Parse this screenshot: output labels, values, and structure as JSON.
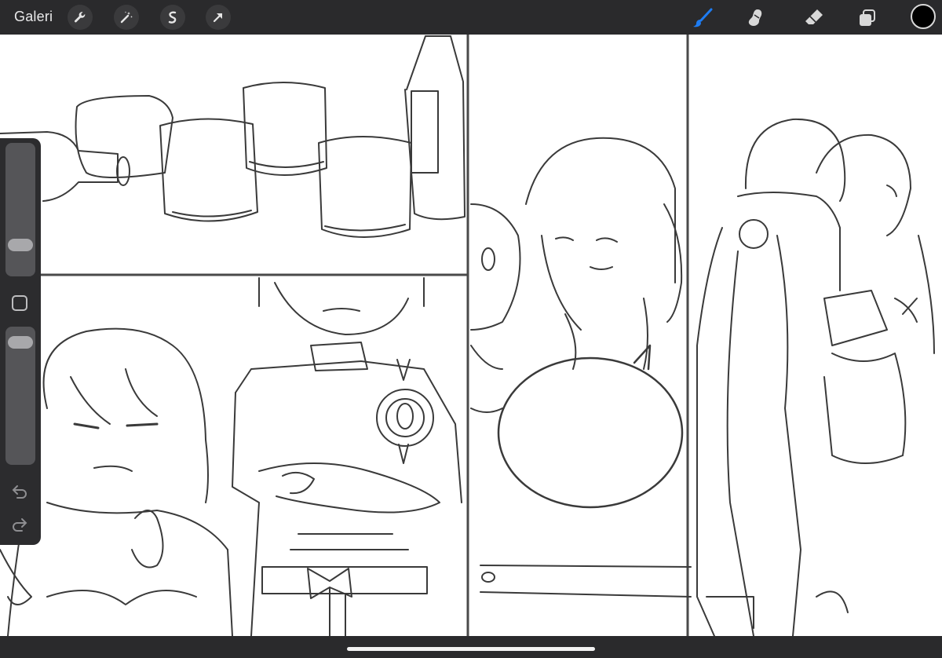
{
  "toolbar": {
    "gallery_label": "Galeri",
    "left_tools": [
      {
        "name": "wrench-icon"
      },
      {
        "name": "magic-wand-icon"
      },
      {
        "name": "selection-icon"
      },
      {
        "name": "transform-arrow-icon"
      }
    ],
    "right_tools": [
      {
        "name": "brush-icon",
        "active_color": "#1e7cf2"
      },
      {
        "name": "smudge-icon"
      },
      {
        "name": "eraser-icon"
      },
      {
        "name": "layers-icon"
      }
    ],
    "current_color": "#000000"
  },
  "sidebar": {
    "brush_size_slider": {
      "name": "brush-size-slider"
    },
    "modify_button": {
      "name": "modify-square-button"
    },
    "opacity_slider": {
      "name": "opacity-slider"
    },
    "undo": {
      "name": "undo-icon"
    },
    "redo": {
      "name": "redo-icon"
    }
  },
  "colors": {
    "toolbar_bg": "#2a2a2c",
    "canvas_bg": "#ffffff",
    "accent": "#1e7cf2"
  }
}
